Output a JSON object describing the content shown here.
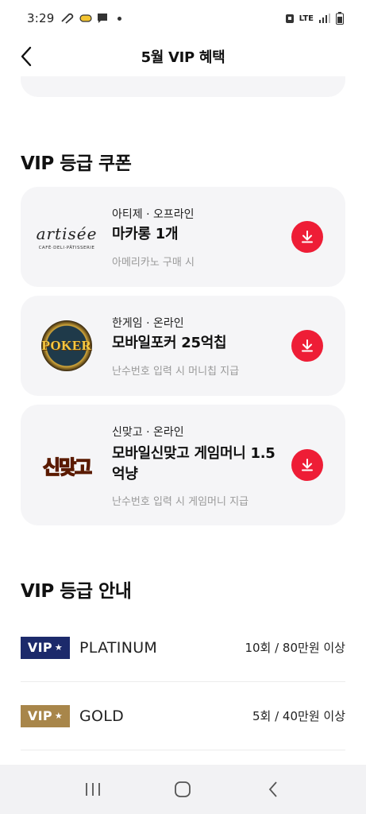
{
  "status": {
    "time": "3:29",
    "network": "LTE"
  },
  "header": {
    "title": "5월 VIP 혜택"
  },
  "coupons_section": {
    "title": "VIP 등급 쿠폰",
    "items": [
      {
        "brand_logo": "artisée",
        "brand_sub": "CAFÉ·DELI·PÂTISSERIE",
        "meta": "아티제 · 오프라인",
        "name": "마카롱 1개",
        "desc": "아메리카노 구매 시"
      },
      {
        "brand_logo": "POKER",
        "meta": "한게임 · 온라인",
        "name": "모바일포커 25억칩",
        "desc": "난수번호 입력 시 머니칩 지급"
      },
      {
        "brand_logo": "신맞고",
        "meta": "신맞고 · 온라인",
        "name": "모바일신맞고 게임머니 1.5억냥",
        "desc": "난수번호 입력 시 게임머니 지급"
      }
    ]
  },
  "grades_section": {
    "title": "VIP 등급 안내",
    "items": [
      {
        "badge": "VIP",
        "name": "PLATINUM",
        "condition": "10회 / 80만원 이상",
        "color": "#1c2a6b"
      },
      {
        "badge": "VIP",
        "name": "GOLD",
        "condition": "5회 / 40만원 이상",
        "color": "#a8864a"
      }
    ]
  },
  "icons": {
    "back": "chevron-left-icon",
    "download": "download-icon",
    "recents": "recents-icon",
    "home": "home-icon",
    "nav_back": "nav-back-icon"
  },
  "colors": {
    "accent": "#ee1d36",
    "card_bg": "#f5f5f7"
  }
}
